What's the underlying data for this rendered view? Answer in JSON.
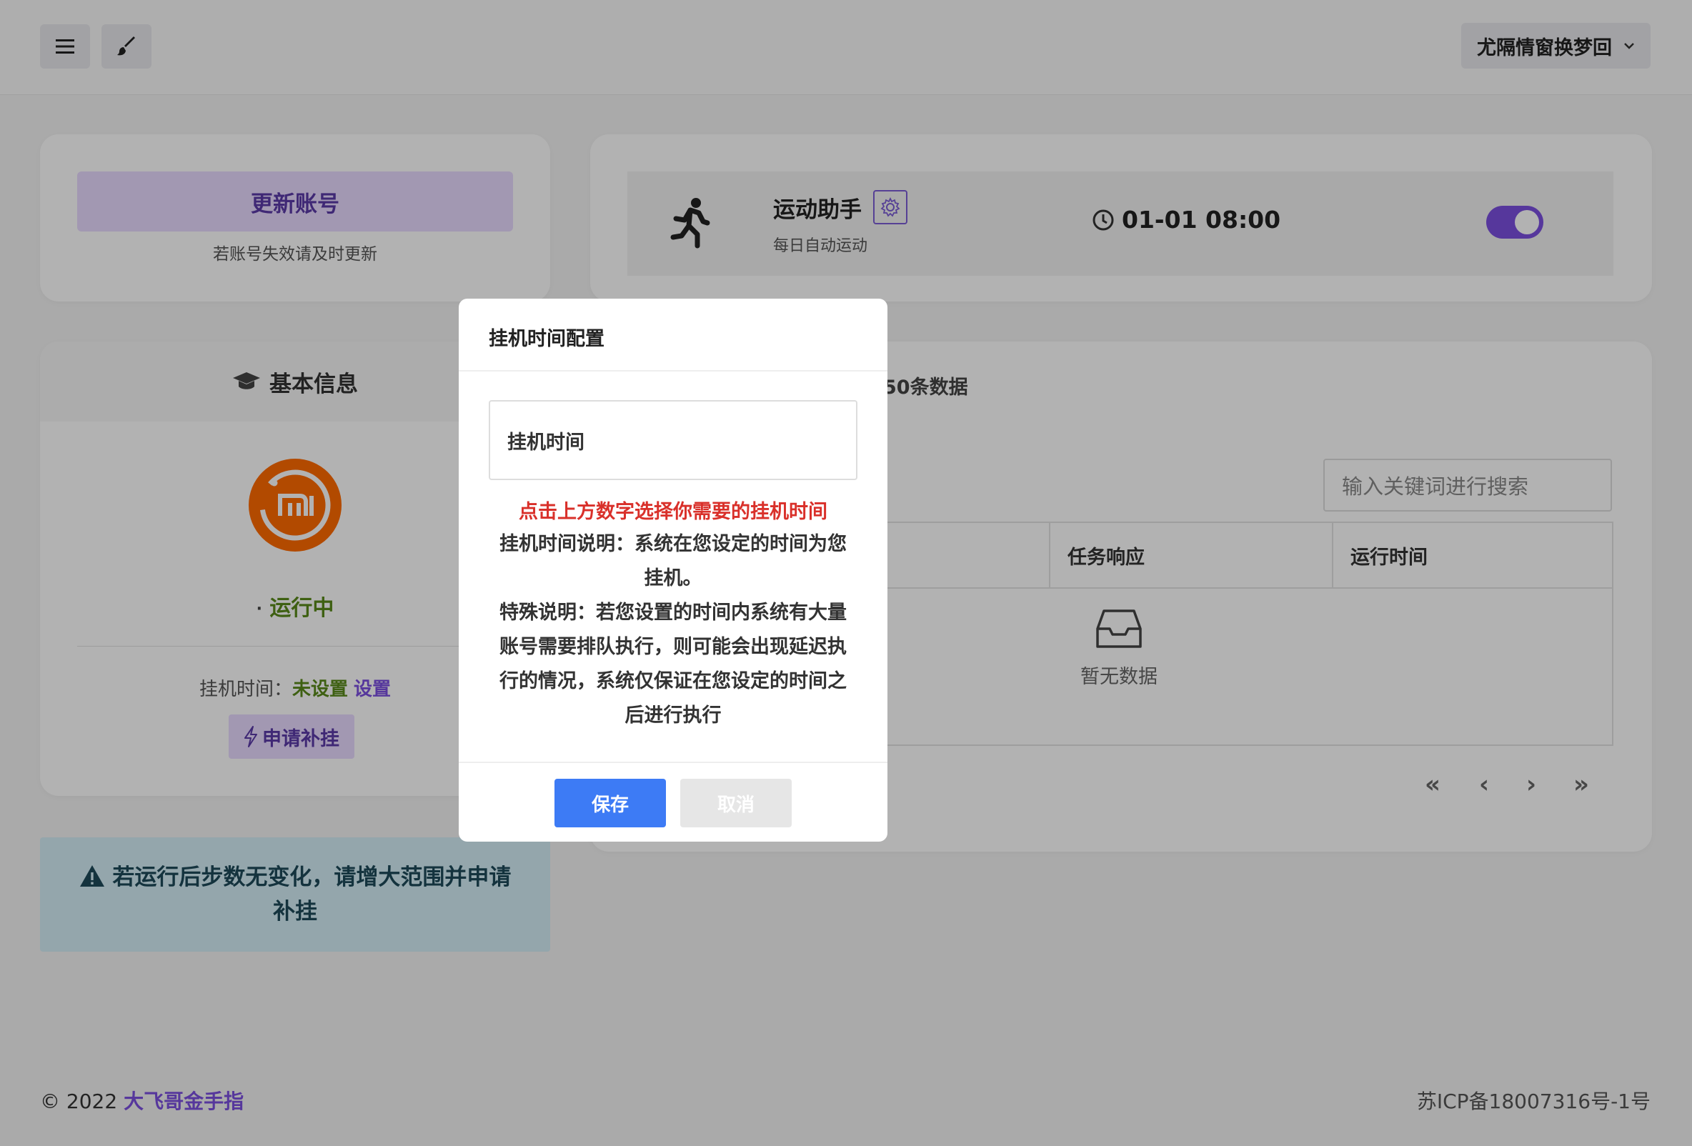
{
  "topbar": {
    "menu_icon": "hamburger-menu-icon",
    "theme_icon": "brush-icon",
    "user_name": "尤隔情窗换梦回"
  },
  "account_card": {
    "update_label": "更新账号",
    "hint": "若账号失效请及时更新"
  },
  "sport_card": {
    "icon": "running-person-icon",
    "title": "运动助手",
    "subtitle": "每日自动运动",
    "time": "01-01 08:00",
    "toggle_on": true,
    "accent": "#7b4fe0"
  },
  "info_card": {
    "title": "基本信息",
    "avatar_icon": "mi-logo-icon",
    "status": "运行中",
    "hang_label": "挂机时间：",
    "hang_value": "未设置",
    "set_link": "设置",
    "apply_label": "申请补挂"
  },
  "alert": {
    "line1": "若运行后步数无变化，请增大范围并申请",
    "line2": "补挂"
  },
  "log_card": {
    "title_fragment": "50条数据",
    "search_placeholder": "输入关键词进行搜索",
    "columns": [
      "任务响应",
      "运行时间"
    ],
    "empty_text": "暂无数据",
    "pager": [
      "«",
      "‹",
      "›",
      "»"
    ]
  },
  "footer": {
    "copyright": "© 2022",
    "brand": "大飞哥金手指",
    "icp": "苏ICP备18007316号-1号"
  },
  "modal": {
    "title": "挂机时间配置",
    "input_label": "挂机时间",
    "red_tip": "点击上方数字选择你需要的挂机时间",
    "desc1": "挂机时间说明：系统在您设定的时间为您挂机。",
    "desc2": "特殊说明：若您设置的时间内系统有大量账号需要排队执行，则可能会出现延迟执行的情况，系统仅保证在您设定的时间之后进行执行",
    "save_label": "保存",
    "cancel_label": "取消"
  }
}
